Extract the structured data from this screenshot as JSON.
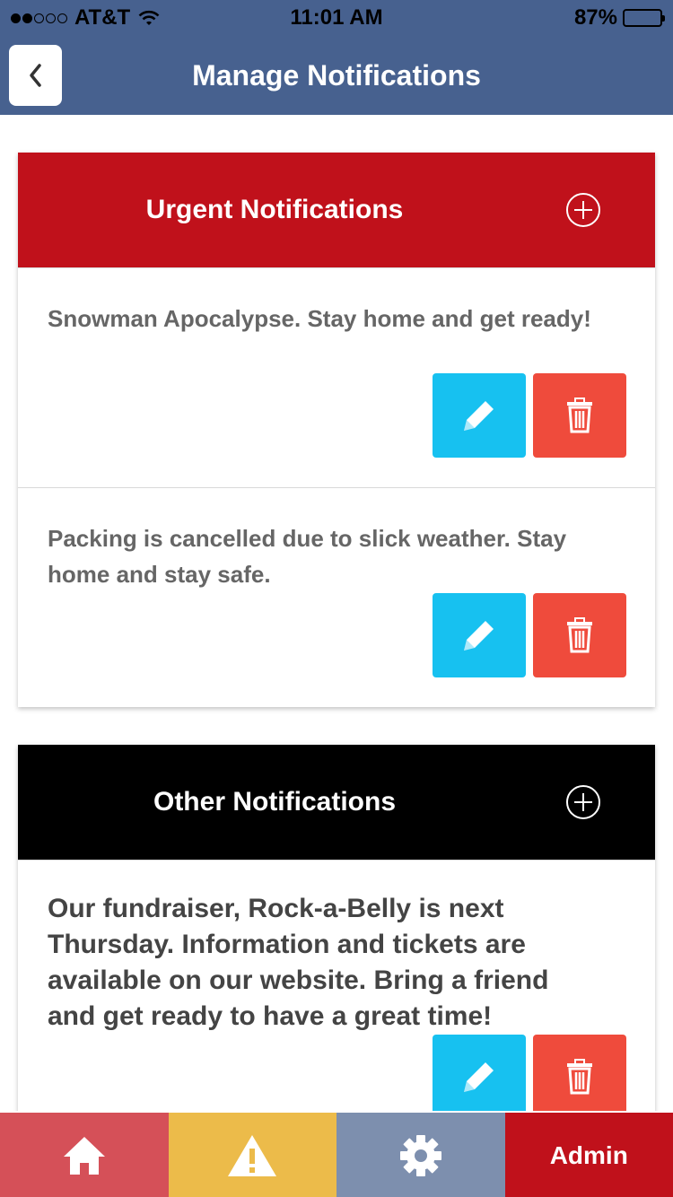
{
  "status_bar": {
    "carrier": "AT&T",
    "time": "11:01 AM",
    "battery": "87%",
    "battery_level": 0.87
  },
  "nav": {
    "title": "Manage Notifications"
  },
  "urgent": {
    "title": "Urgent Notifications",
    "color": "#c0111b",
    "items": [
      {
        "text": "Snowman Apocalypse. Stay home and get ready!"
      },
      {
        "text": "Packing is cancelled due to slick weather. Stay home and stay safe."
      }
    ]
  },
  "other": {
    "title": "Other Notifications",
    "color": "#000000",
    "items": [
      {
        "text": "Our fundraiser, Rock-a-Belly is next Thursday. Information and tickets are available on our website. Bring a friend and get ready to have a great time!"
      }
    ]
  },
  "tabs": [
    {
      "icon": "home-icon",
      "color": "#d55058"
    },
    {
      "icon": "warning-icon",
      "color": "#ecbb4a"
    },
    {
      "icon": "gear-icon",
      "color": "#7d8fae"
    },
    {
      "label": "Admin",
      "color": "#c0111b"
    }
  ]
}
